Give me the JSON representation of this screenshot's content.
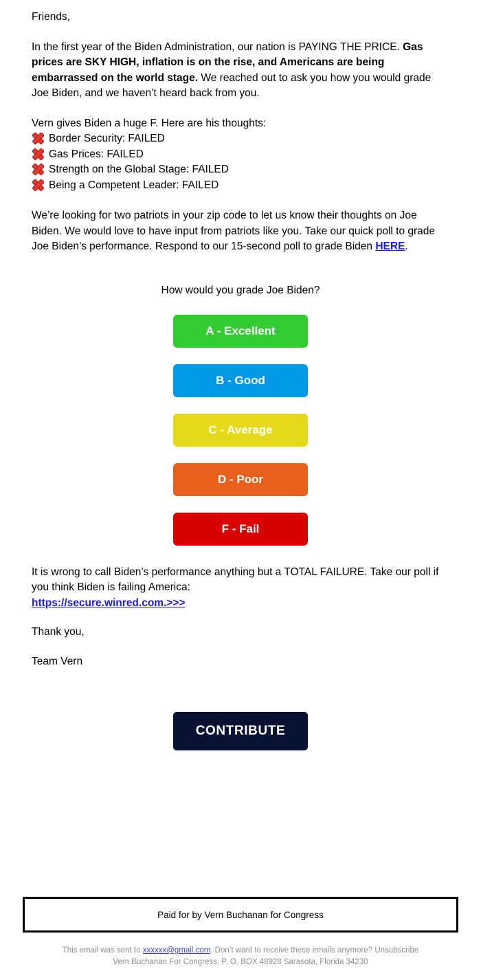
{
  "email": {
    "greeting": "Friends,",
    "intro": {
      "lead": "In the first year of the Biden Administration, our nation is PAYING THE PRICE. ",
      "bold": "Gas prices are SKY HIGH, inflation is on the rise, and Americans are being embarrassed on the world stage.",
      "tail": " We reached out to ask you how you would grade Joe Biden, and we haven’t heard back from you."
    },
    "list_heading": "Vern gives Biden a huge F. Here are his thoughts:",
    "fail_items": [
      "Border Security: FAILED",
      "Gas Prices: FAILED",
      "Strength on the Global Stage: FAILED",
      "Being a Competent Leader: FAILED"
    ],
    "poll_paragraph": {
      "before": "We’re looking for two patriots in your zip code to let us know their thoughts on Joe Biden. We would love to have input from patriots like you. Take our quick poll to grade Joe Biden’s performance. Respond to our 15-second poll to grade Biden ",
      "link": "HERE",
      "after": "."
    },
    "grade_question": "How would you grade Joe Biden?",
    "grade_buttons": [
      {
        "label": "A - Excellent",
        "color": "#33cc33"
      },
      {
        "label": "B - Good",
        "color": "#0099e5"
      },
      {
        "label": "C - Average",
        "color": "#e5d91a"
      },
      {
        "label": "D - Poor",
        "color": "#e8601c"
      },
      {
        "label": "F - Fail",
        "color": "#d90000"
      }
    ],
    "closing_paragraph": "It is wrong to call Biden’s performance anything but a TOTAL FAILURE. Take our poll if you think Biden is failing America:",
    "closing_link": "https://secure.winred.com.>>>",
    "thank_you": "Thank you,",
    "signature": "Team Vern",
    "contribute_label": "CONTRIBUTE"
  },
  "disclaimer": {
    "paid_for": "Paid for by Vern Buchanan for Congress"
  },
  "footer": {
    "sent_prefix": "This email was sent to ",
    "email_address": "xxxxxx@gmail.com",
    "sent_suffix": ". Don’t want to receive these emails anymore? Unsubscribe",
    "address_line": "Vern Buchanan For Congress, P. O. BOX 48928 Sarasota, Florida 34230"
  },
  "colors": {
    "link": "#1a1ae6",
    "contribute_bg": "#0a1233",
    "xmark_red": "#e8392f",
    "footer_text": "#8d8d8d"
  }
}
